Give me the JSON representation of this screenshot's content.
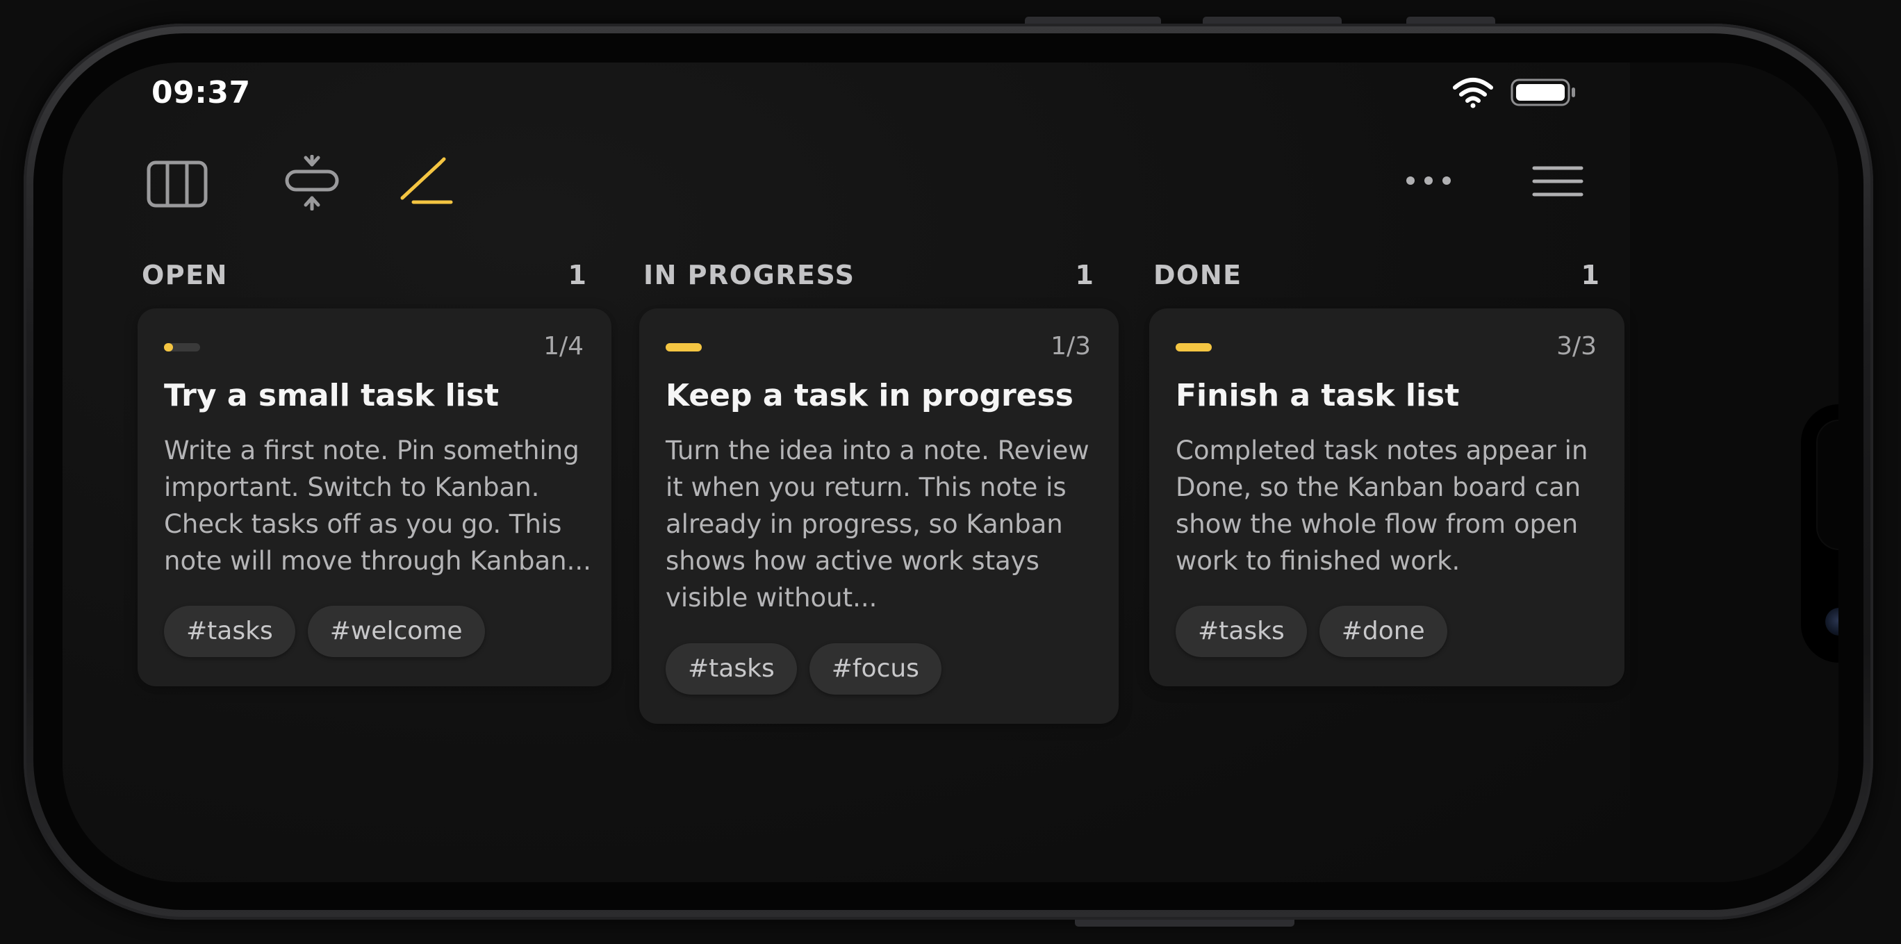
{
  "status_bar": {
    "time": "09:37"
  },
  "toolbar": {
    "icons": [
      "kanban-view-icon",
      "collapse-icon",
      "edit-icon",
      "more-icon",
      "menu-icon"
    ],
    "accent_color": "#f4c542"
  },
  "columns": [
    {
      "title": "OPEN",
      "count": "1",
      "card": {
        "progress_label": "1/4",
        "progress": 0.25,
        "title": "Try a small task list",
        "body": "Write a first note. Pin something important. Switch to Kanban. Check tasks off as you go. This note will move through Kanban...",
        "tags": [
          "#tasks",
          "#welcome"
        ]
      }
    },
    {
      "title": "IN PROGRESS",
      "count": "1",
      "card": {
        "progress_label": "1/3",
        "progress": 1.0,
        "title": "Keep a task in progress",
        "body": "Turn the idea into a note. Review it when you return. This note is already in progress, so Kanban shows how active work stays visible without...",
        "tags": [
          "#tasks",
          "#focus"
        ]
      }
    },
    {
      "title": "DONE",
      "count": "1",
      "card": {
        "progress_label": "3/3",
        "progress": 1.0,
        "title": "Finish a task list",
        "body": "Completed task notes appear in Done, so the Kanban board can show the whole flow from open work to finished work.",
        "tags": [
          "#tasks",
          "#done"
        ]
      }
    }
  ]
}
